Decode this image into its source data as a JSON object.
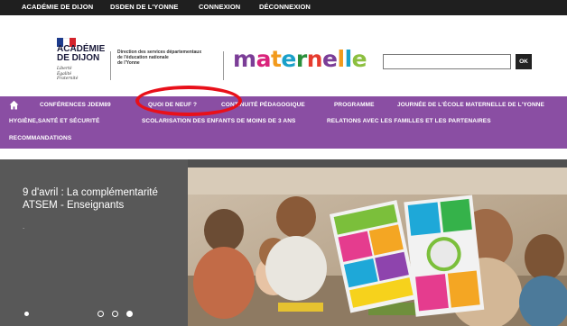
{
  "topbar": {
    "links": [
      "ACADÉMIE DE DIJON",
      "DSDEN DE L'YONNE",
      "CONNEXION",
      "DÉCONNEXION"
    ]
  },
  "header": {
    "academie_name": "ACADÉMIE\nDE DIJON",
    "motto": "Liberté\nÉgalité\nFraternité",
    "direction_text": "Direction des services départementaux\nde l'éducation nationale\nde l'Yonne",
    "logo_text": "maternelle",
    "logo_colors": [
      "#7b3d97",
      "#d9237b",
      "#f29a1c",
      "#1aa0c9",
      "#2a8f3b",
      "#e63b2e",
      "#7b3d97",
      "#f29a1c",
      "#1aa0c9",
      "#8cbf3f"
    ],
    "search": {
      "value": "",
      "placeholder": ""
    },
    "ok_label": "OK"
  },
  "nav": {
    "row1": [
      "CONFÉRENCES JDEM89",
      "QUOI DE NEUF ?",
      "CONTINUITÉ PÉDAGOGIQUE",
      "PROGRAMME",
      "JOURNÉE DE L'ÉCOLE MATERNELLE DE L'YONNE"
    ],
    "row2": [
      "HYGIÈNE,SANTÉ ET SÉCURITÉ",
      "SCOLARISATION DES ENFANTS DE MOINS DE 3 ANS",
      "RELATIONS AVEC LES FAMILLES ET LES PARTENAIRES"
    ],
    "row3": [
      "RECOMMANDATIONS"
    ],
    "highlighted_item": "QUOI DE NEUF ?"
  },
  "slider": {
    "title": "9 d'avril : La complémentarité ATSEM - Enseignants",
    "subtitle": ".",
    "dots": [
      false,
      false,
      true
    ],
    "active_slide": 3
  },
  "colors": {
    "topbar": "#1f1f1f",
    "nav": "#8a4ea3",
    "highlight": "#e8101a",
    "slider_bg": "#505050"
  }
}
